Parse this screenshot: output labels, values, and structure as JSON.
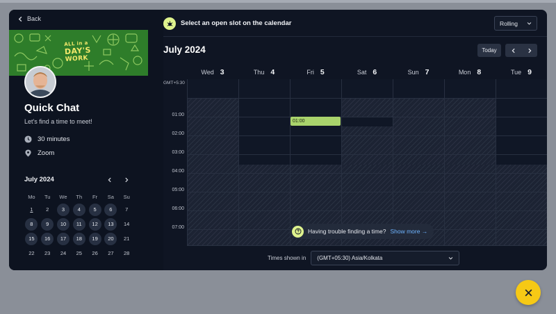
{
  "back_label": "Back",
  "banner": {
    "line1": "ALL in a",
    "line2": "DAY'S",
    "line3": "WORK"
  },
  "event": {
    "title": "Quick Chat",
    "subtitle": "Let's find a time to meet!",
    "duration": "30 minutes",
    "location": "Zoom"
  },
  "mini_calendar": {
    "month": "July 2024",
    "weekdays": [
      "Mo",
      "Tu",
      "We",
      "Th",
      "Fr",
      "Sa",
      "Su"
    ],
    "days": [
      {
        "d": "1",
        "s": "today"
      },
      {
        "d": "2",
        "s": ""
      },
      {
        "d": "3",
        "s": "avail"
      },
      {
        "d": "4",
        "s": "avail"
      },
      {
        "d": "5",
        "s": "avail"
      },
      {
        "d": "6",
        "s": "avail"
      },
      {
        "d": "7",
        "s": ""
      },
      {
        "d": "8",
        "s": "avail"
      },
      {
        "d": "9",
        "s": "avail"
      },
      {
        "d": "10",
        "s": "avail"
      },
      {
        "d": "11",
        "s": "avail"
      },
      {
        "d": "12",
        "s": "avail"
      },
      {
        "d": "13",
        "s": "avail"
      },
      {
        "d": "14",
        "s": ""
      },
      {
        "d": "15",
        "s": "avail"
      },
      {
        "d": "16",
        "s": "avail"
      },
      {
        "d": "17",
        "s": "avail"
      },
      {
        "d": "18",
        "s": "avail"
      },
      {
        "d": "19",
        "s": "avail"
      },
      {
        "d": "20",
        "s": "avail"
      },
      {
        "d": "21",
        "s": ""
      },
      {
        "d": "22",
        "s": ""
      },
      {
        "d": "23",
        "s": ""
      },
      {
        "d": "24",
        "s": ""
      },
      {
        "d": "25",
        "s": ""
      },
      {
        "d": "26",
        "s": ""
      },
      {
        "d": "27",
        "s": ""
      },
      {
        "d": "28",
        "s": ""
      }
    ]
  },
  "header": {
    "instruction": "Select an open slot on the calendar",
    "view_select": "Rolling"
  },
  "calendar": {
    "month_title": "July 2024",
    "today_button": "Today",
    "timezone_short": "GMT+5:30",
    "days": [
      {
        "name": "Wed",
        "num": "3"
      },
      {
        "name": "Thu",
        "num": "4"
      },
      {
        "name": "Fri",
        "num": "5"
      },
      {
        "name": "Sat",
        "num": "6"
      },
      {
        "name": "Sun",
        "num": "7"
      },
      {
        "name": "Mon",
        "num": "8"
      },
      {
        "name": "Tue",
        "num": "9"
      }
    ],
    "hours": [
      "01:00",
      "02:00",
      "03:00",
      "04:00",
      "05:00",
      "06:00",
      "07:00"
    ],
    "slot_label": "01:00"
  },
  "help": {
    "text": "Having trouble finding a time?",
    "link": "Show more →"
  },
  "timezone": {
    "label": "Times shown in",
    "value": "(GMT+05:30) Asia/Kolkata"
  },
  "colors": {
    "accent": "#dff38e",
    "slot": "#a9d36c",
    "fab": "#f6c915",
    "panel": "#0f1523"
  }
}
